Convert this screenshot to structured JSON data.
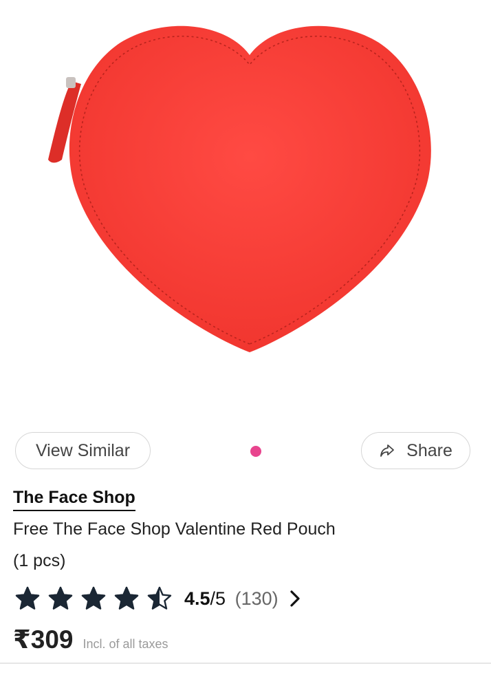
{
  "product": {
    "image_icon": "heart-pouch-image",
    "brand": "The Face Shop",
    "title": "Free The Face Shop Valentine Red Pouch",
    "quantity": "(1 pcs)",
    "pouch_color": "#fb3b34"
  },
  "actions": {
    "view_similar_label": "View Similar",
    "share_label": "Share",
    "share_icon": "share-arrow-icon",
    "carousel_dot_color": "#e8448e"
  },
  "rating": {
    "stars_filled": 4.5,
    "stars_total": 5,
    "score": "4.5",
    "out_of": "/5",
    "count": "(130)",
    "star_icon": "star-icon",
    "chevron_icon": "chevron-right-icon"
  },
  "price": {
    "amount": "₹309",
    "tax_note": "Incl. of all taxes"
  }
}
